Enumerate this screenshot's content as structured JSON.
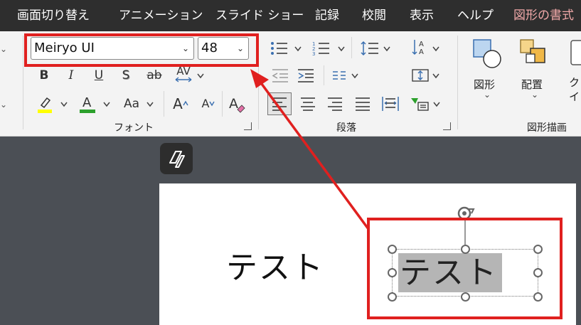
{
  "menu": {
    "items": [
      "画面切り替え",
      "アニメーション",
      "スライド ショー",
      "記録",
      "校閲",
      "表示",
      "ヘルプ",
      "図形の書式"
    ]
  },
  "ribbon": {
    "font_group": {
      "font_name": "Meiryo UI",
      "font_size": "48",
      "bold": "B",
      "italic": "I",
      "underline": "U",
      "shadow": "S",
      "strikethrough": "ab",
      "char_spacing": "AV",
      "change_case": "Aa",
      "grow_font": "A",
      "shrink_font": "A",
      "label": "フォント"
    },
    "paragraph_group": {
      "label": "段落"
    },
    "drawing_group": {
      "shapes_label": "図形",
      "arrange_label": "配置",
      "quick_styles_label": "クイック スタイル",
      "label": "図形描画"
    }
  },
  "slide": {
    "text_left": "テスト",
    "text_selected": "テスト"
  },
  "colors": {
    "annotation": "#e0201f",
    "highlight_yellow": "#ffff00",
    "font_green": "#2ca02c",
    "menu_accent": "#f0a8a8"
  }
}
